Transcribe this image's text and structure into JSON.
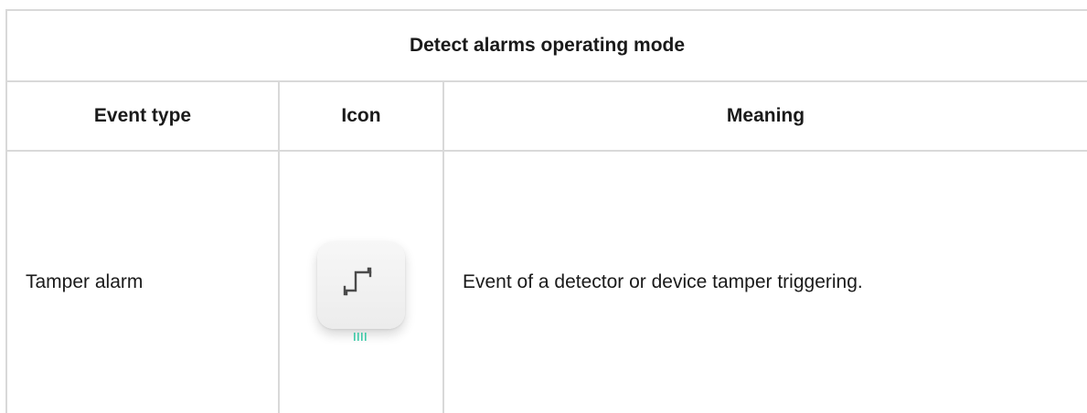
{
  "table": {
    "title": "Detect alarms operating mode",
    "headers": [
      "Event type",
      "Icon",
      "Meaning"
    ],
    "rows": [
      {
        "event_type": "Tamper alarm",
        "icon": "tamper-icon",
        "meaning": "Event of a detector or device tamper triggering."
      }
    ]
  },
  "colors": {
    "border": "#d9d9d9",
    "text": "#1a1a1a",
    "icon_glyph": "#4a4a4a",
    "icon_leds": "#3ec9a7"
  }
}
